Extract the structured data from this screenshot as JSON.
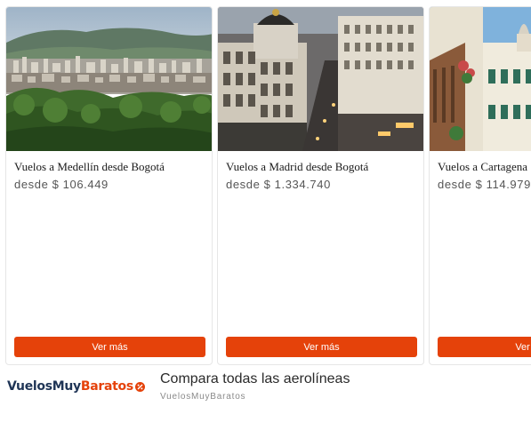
{
  "cards": [
    {
      "image": "medellin-city-photo",
      "title": "Vuelos a Medellín desde Bogotá",
      "price": "desde $ 106.449",
      "button_label": "Ver más"
    },
    {
      "image": "madrid-gran-via-photo",
      "title": "Vuelos a Madrid desde Bogotá",
      "price": "desde $ 1.334.740",
      "button_label": "Ver más"
    },
    {
      "image": "cartagena-colonial-photo",
      "title": "Vuelos a Cartagena",
      "price": "desde $ 114.979",
      "button_label": "Ver más"
    }
  ],
  "footer": {
    "brand_part_a": "VuelosMuy",
    "brand_part_b": "Baratos",
    "headline": "Compara todas las aerolíneas",
    "advertiser": "VuelosMuyBaratos"
  },
  "colors": {
    "accent": "#e5420a",
    "brand_dark": "#1f3556"
  }
}
